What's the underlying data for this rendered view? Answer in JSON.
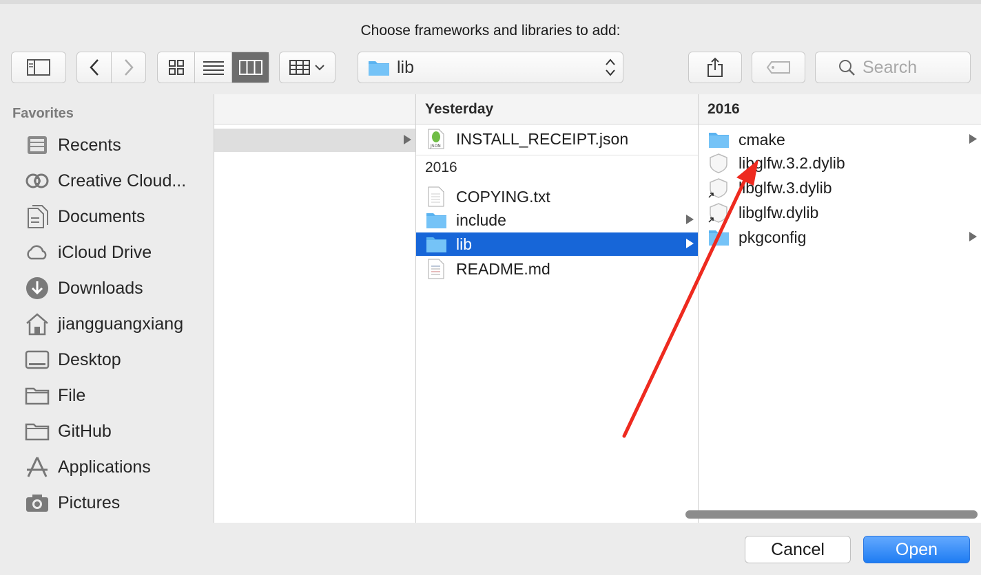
{
  "dialog": {
    "title": "Choose frameworks and libraries to add:"
  },
  "toolbar": {
    "path_label": "lib",
    "search_placeholder": "Search"
  },
  "sidebar": {
    "section_title": "Favorites",
    "items": [
      {
        "label": "Recents",
        "icon": "recents-icon"
      },
      {
        "label": "Creative Cloud...",
        "icon": "creative-cloud-icon"
      },
      {
        "label": "Documents",
        "icon": "documents-icon"
      },
      {
        "label": "iCloud Drive",
        "icon": "icloud-icon"
      },
      {
        "label": "Downloads",
        "icon": "downloads-icon"
      },
      {
        "label": "jiangguangxiang",
        "icon": "home-icon"
      },
      {
        "label": "Desktop",
        "icon": "desktop-icon"
      },
      {
        "label": "File",
        "icon": "folder-icon"
      },
      {
        "label": "GitHub",
        "icon": "folder-icon"
      },
      {
        "label": "Applications",
        "icon": "applications-icon"
      },
      {
        "label": "Pictures",
        "icon": "camera-icon"
      }
    ]
  },
  "columns": {
    "middle": {
      "header": "Yesterday",
      "top_item": "INSTALL_RECEIPT.json",
      "group_label": "2016",
      "items": [
        "COPYING.txt",
        "include",
        "lib",
        "README.md"
      ]
    },
    "right": {
      "header": "2016",
      "items": [
        "cmake",
        "libglfw.3.2.dylib",
        "libglfw.3.dylib",
        "libglfw.dylib",
        "pkgconfig"
      ]
    }
  },
  "buttons": {
    "cancel": "Cancel",
    "open": "Open"
  },
  "colors": {
    "selection": "#1766d8",
    "open_button": "#1e7cf2",
    "annotation_arrow": "#ee2a1f"
  }
}
